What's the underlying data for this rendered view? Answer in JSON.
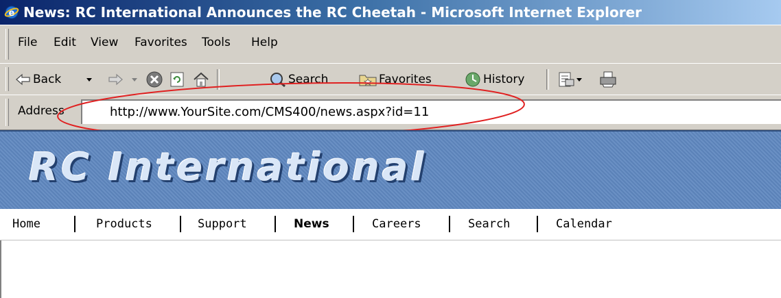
{
  "window": {
    "title": "News: RC International Announces the RC Cheetah - Microsoft Internet Explorer"
  },
  "menubar": {
    "items": [
      "File",
      "Edit",
      "View",
      "Favorites",
      "Tools",
      "Help"
    ]
  },
  "toolbar": {
    "back_label": "Back",
    "search_label": "Search",
    "favorites_label": "Favorites",
    "history_label": "History"
  },
  "address": {
    "label": "Address",
    "url": "http://www.YourSite.com/CMS400/news.aspx?id=11",
    "highlight_color": "#e02020"
  },
  "site": {
    "logo_text": "RC International",
    "nav": {
      "items": [
        "Home",
        "Products",
        "Support",
        "News",
        "Careers",
        "Search",
        "Calendar"
      ],
      "active": "News"
    }
  },
  "colors": {
    "titlebar_start": "#0a246a",
    "chrome": "#d4d0c8",
    "banner": "#5b82b8"
  }
}
